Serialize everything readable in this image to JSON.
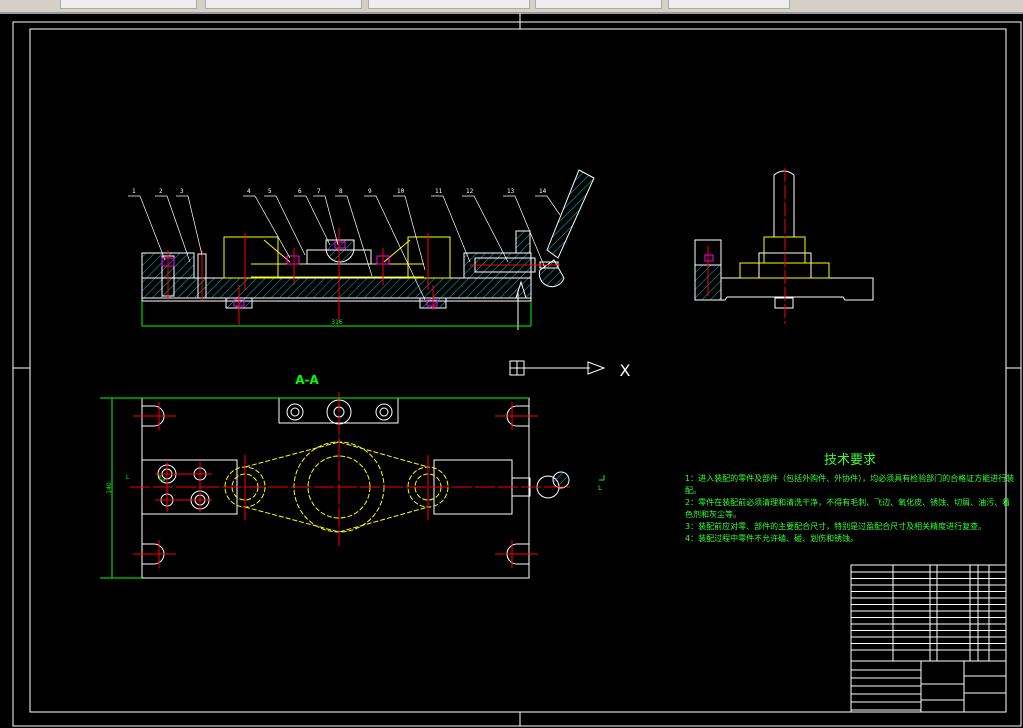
{
  "part_numbers": [
    "1",
    "2",
    "3",
    "4",
    "5",
    "6",
    "7",
    "8",
    "9",
    "10",
    "11",
    "12",
    "13",
    "14"
  ],
  "front_view": {
    "length_dim": "316"
  },
  "section_view": {
    "title": "A-A",
    "width_dim": "140",
    "section_mark_left": "L",
    "section_mark_right": "L"
  },
  "ucs": {
    "x_label": "X"
  },
  "tech_requirements": {
    "title": "技术要求",
    "items": [
      "1：进入装配的零件及部件（包括外购件、外协件），均必须具有检验部门的合格证方能进行装配。",
      "2：零件在装配前必须清理和清洗干净，不得有毛刺、飞边、氧化皮、锈蚀、切屑、油污、着色剂和灰尘等。",
      "3：装配前应对零、部件的主要配合尺寸，特别是过盈配合尺寸及相关精度进行复查。",
      "4：装配过程中零件不允许磕、碰、划伤和锈蚀。"
    ]
  },
  "colors": {
    "background": "#000000",
    "outline": "#ffffff",
    "hatch": "#00e5ff",
    "center": "#ff0000",
    "workpiece": "#ffff00",
    "dimension": "#00ff00",
    "fastener": "#ff00ff"
  }
}
